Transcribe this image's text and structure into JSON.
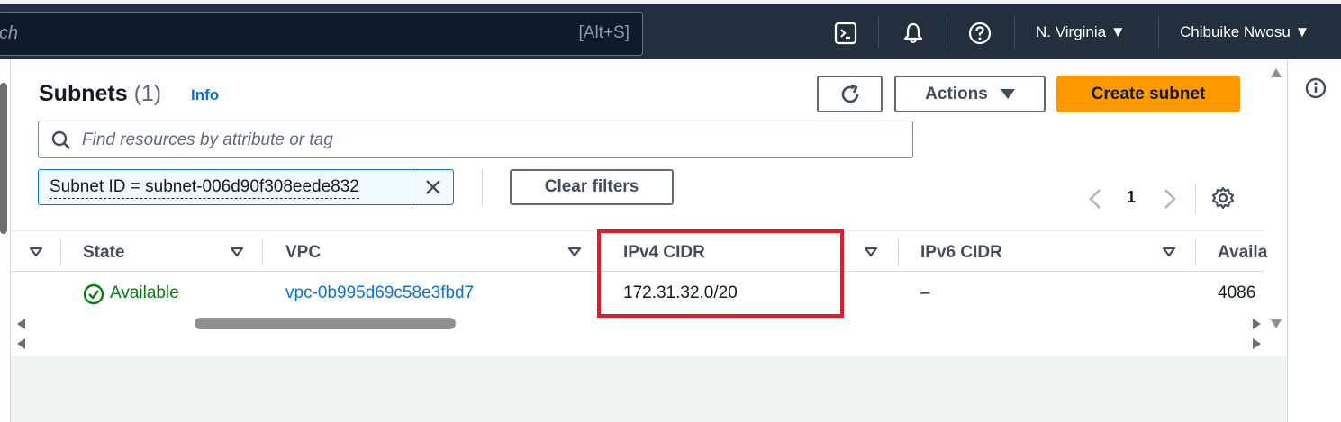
{
  "topbar": {
    "search_text": "ch",
    "search_shortcut": "[Alt+S]",
    "region": "N. Virginia ▼",
    "user": "Chibuike Nwosu ▼",
    "icons": [
      "cloudshell-icon",
      "bell-icon",
      "help-icon"
    ]
  },
  "panel": {
    "title": "Subnets",
    "count": "(1)",
    "info": "Info",
    "actions_label": "Actions",
    "create_label": "Create subnet",
    "search_placeholder": "Find resources by attribute or tag",
    "filter_token": "Subnet ID = subnet-006d90f308eede832",
    "clear_filters": "Clear filters",
    "page_number": "1"
  },
  "table": {
    "columns": [
      "State",
      "VPC",
      "IPv4 CIDR",
      "IPv6 CIDR",
      "Availa"
    ],
    "rows": [
      {
        "state": "Available",
        "vpc": "vpc-0b995d69c58e3fbd7",
        "ipv4": "172.31.32.0/20",
        "ipv6": "–",
        "available": "4086"
      }
    ]
  },
  "colors": {
    "topbar": "#232f3e",
    "accent_orange": "#ff9900",
    "link_blue": "#0972d3",
    "status_green": "#037f0c",
    "highlight_red": "#e21b28"
  }
}
